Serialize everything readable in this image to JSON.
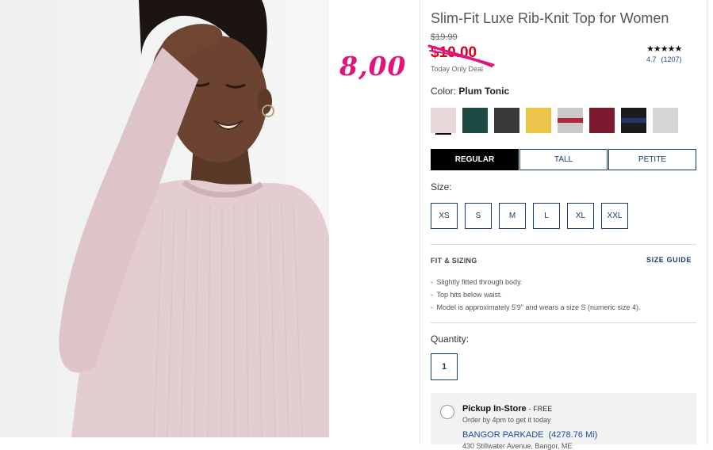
{
  "product": {
    "title": "Slim-Fit Luxe Rib-Knit Top for Women",
    "was_price": "$19.99",
    "now_price": "$10.00",
    "deal_label": "Today Only Deal",
    "handwritten_price": "8,00"
  },
  "rating": {
    "stars": "★★★★★",
    "value": "4.7",
    "count": "(1207)"
  },
  "color": {
    "label": "Color:",
    "selected": "Plum Tonic",
    "swatches": [
      {
        "name": "plum-tonic",
        "color": "#e8d8da",
        "selected": true
      },
      {
        "name": "dark-green",
        "color": "#1d4a43"
      },
      {
        "name": "charcoal",
        "color": "#3a3a3a"
      },
      {
        "name": "mustard",
        "color": "#ebc64a"
      },
      {
        "name": "heather-gray-red-stripe",
        "color": "#c9c9c9",
        "stripe": "#b3283e"
      },
      {
        "name": "burgundy",
        "color": "#7c1a30"
      },
      {
        "name": "black-navy-stripe",
        "color": "#1b1b1b",
        "stripe": "#23346e"
      },
      {
        "name": "light-heather-gray",
        "color": "#d6d6d6"
      }
    ]
  },
  "fit_options": [
    "REGULAR",
    "TALL",
    "PETITE"
  ],
  "size": {
    "label": "Size:",
    "options": [
      "XS",
      "S",
      "M",
      "L",
      "XL",
      "XXL"
    ]
  },
  "fit_sizing": {
    "heading": "FIT & SIZING",
    "guide_link": "SIZE GUIDE",
    "items": [
      "Slightly fitted through body.",
      "Top hits below waist.",
      "Model is approximately 5'9\" and wears a size S (numeric size 4)."
    ]
  },
  "quantity": {
    "label": "Quantity:",
    "value": "1"
  },
  "pickup": {
    "title": "Pickup In-Store",
    "free": "- FREE",
    "subtitle": "Order by 4pm to get it today",
    "store": "BANGOR PARKADE",
    "distance": "(4278.76 Mi)",
    "address": "430 Stillwater Avenue, Bangor, ME"
  }
}
